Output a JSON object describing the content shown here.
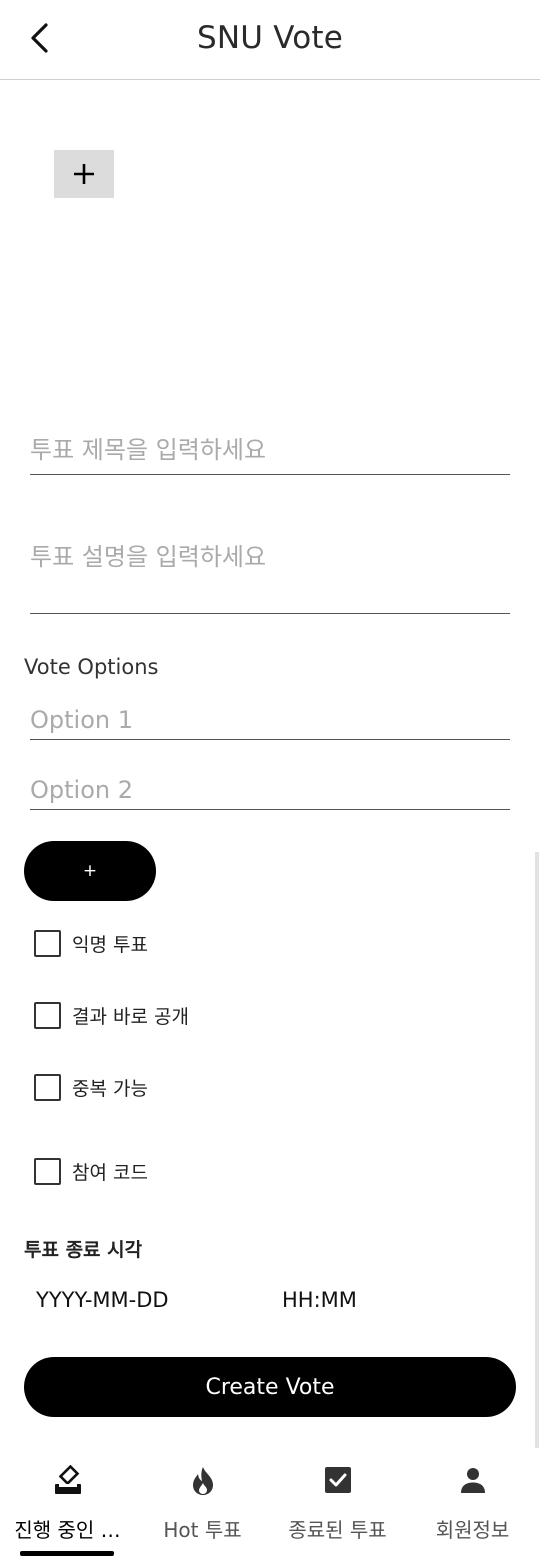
{
  "header": {
    "title": "SNU Vote",
    "back_icon": "chevron-left-icon"
  },
  "image_picker": {
    "add_icon": "plus-icon"
  },
  "form": {
    "title_placeholder": "투표 제목을 입력하세요",
    "description_placeholder": "투표 설명을 입력하세요",
    "options_label": "Vote Options",
    "options": [
      {
        "placeholder": "Option 1",
        "value": ""
      },
      {
        "placeholder": "Option 2",
        "value": ""
      }
    ],
    "add_option_label": "+",
    "checkboxes": [
      {
        "label": "익명 투표",
        "checked": false
      },
      {
        "label": "결과 바로 공개",
        "checked": false
      },
      {
        "label": "중복 가능",
        "checked": false
      },
      {
        "label": "참여 코드",
        "checked": false
      }
    ],
    "end_time_label": "투표 종료 시각",
    "date_placeholder": "YYYY-MM-DD",
    "time_placeholder": "HH:MM",
    "submit_label": "Create Vote"
  },
  "tabbar": {
    "items": [
      {
        "label": "진행 중인 …",
        "icon": "ballot-box-icon",
        "active": true
      },
      {
        "label": "Hot 투표",
        "icon": "fire-icon",
        "active": false
      },
      {
        "label": "종료된 투표",
        "icon": "checkbox-checked-icon",
        "active": false
      },
      {
        "label": "회원정보",
        "icon": "person-icon",
        "active": false
      }
    ]
  },
  "colors": {
    "primary": "#000000",
    "placeholder": "#aaaaaa",
    "input_background": "#dcdcdc",
    "tab_inactive": "#555555"
  }
}
